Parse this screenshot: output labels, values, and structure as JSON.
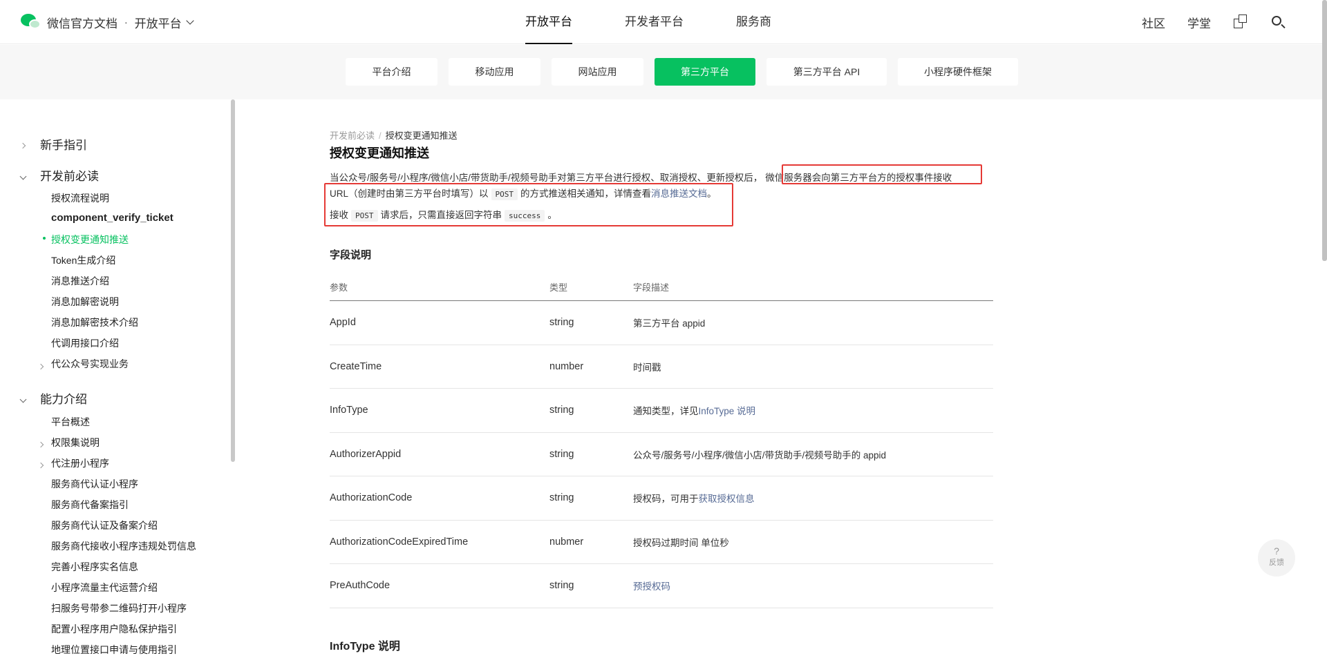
{
  "header": {
    "site_name": "微信官方文档",
    "dot": "·",
    "platform": "开放平台",
    "main_nav": [
      "开放平台",
      "开发者平台",
      "服务商"
    ],
    "right_nav": [
      "社区",
      "学堂"
    ]
  },
  "subtabs": [
    "平台介绍",
    "移动应用",
    "网站应用",
    "第三方平台",
    "第三方平台 API",
    "小程序硬件框架"
  ],
  "sidebar": {
    "groups": [
      "新手指引",
      "开发前必读",
      "能力介绍"
    ],
    "items": [
      "授权流程说明",
      "component_verify_ticket",
      "授权变更通知推送",
      "Token生成介绍",
      "消息推送介绍",
      "消息加解密说明",
      "消息加解密技术介绍",
      "代调用接口介绍",
      "代公众号实现业务",
      "平台概述",
      "权限集说明",
      "代注册小程序",
      "服务商代认证小程序",
      "服务商代备案指引",
      "服务商代认证及备案介绍",
      "服务商代接收小程序违规处罚信息",
      "完善小程序实名信息",
      "小程序流量主代运营介绍",
      "扫服务号带参二维码打开小程序",
      "配置小程序用户隐私保护指引",
      "地理位置接口申请与使用指引"
    ]
  },
  "content": {
    "breadcrumb": [
      "开发前必读",
      "/",
      "授权变更通知推送"
    ],
    "title": "授权变更通知推送",
    "para1_a": "当公众号/服务号/小程序/微信小店/带货助手/视频号助手对第三方平台进行授权、取消授权、更新授权后，",
    "para1_b": "微信服务器会向第三方平台方的授权事件接收",
    "para2_a": "URL（创建时由第三方平台时填写）以",
    "para2_code": "POST",
    "para2_b": "的方式推送相关通知，详情查看",
    "para2_link": "消息推送文档",
    "para2_end": "。",
    "para3_a": "接收",
    "para3_code1": "POST",
    "para3_b": "请求后，只需直接返回字符串",
    "para3_code2": "success",
    "para3_end": "。",
    "section_fields": "字段说明",
    "table": {
      "headers": [
        "参数",
        "类型",
        "字段描述"
      ],
      "rows": [
        {
          "param": "AppId",
          "type": "string",
          "desc": "第三方平台 appid",
          "link": ""
        },
        {
          "param": "CreateTime",
          "type": "number",
          "desc": "时间戳",
          "link": ""
        },
        {
          "param": "InfoType",
          "type": "string",
          "desc": "通知类型，详见",
          "link": "InfoType 说明"
        },
        {
          "param": "AuthorizerAppid",
          "type": "string",
          "desc": "公众号/服务号/小程序/微信小店/带货助手/视频号助手的 appid",
          "link": ""
        },
        {
          "param": "AuthorizationCode",
          "type": "string",
          "desc": "授权码，可用于",
          "link": "获取授权信息"
        },
        {
          "param": "AuthorizationCodeExpiredTime",
          "type": "nubmer",
          "desc": "授权码过期时间 单位秒",
          "link": ""
        },
        {
          "param": "PreAuthCode",
          "type": "string",
          "desc": "",
          "link": "预授权码"
        }
      ]
    },
    "section_infotype": "InfoType 说明"
  },
  "feedback": {
    "icon": "?",
    "label": "反馈"
  },
  "colors": {
    "accent": "#07c160",
    "link": "#576b95",
    "highlight": "#e53935"
  }
}
